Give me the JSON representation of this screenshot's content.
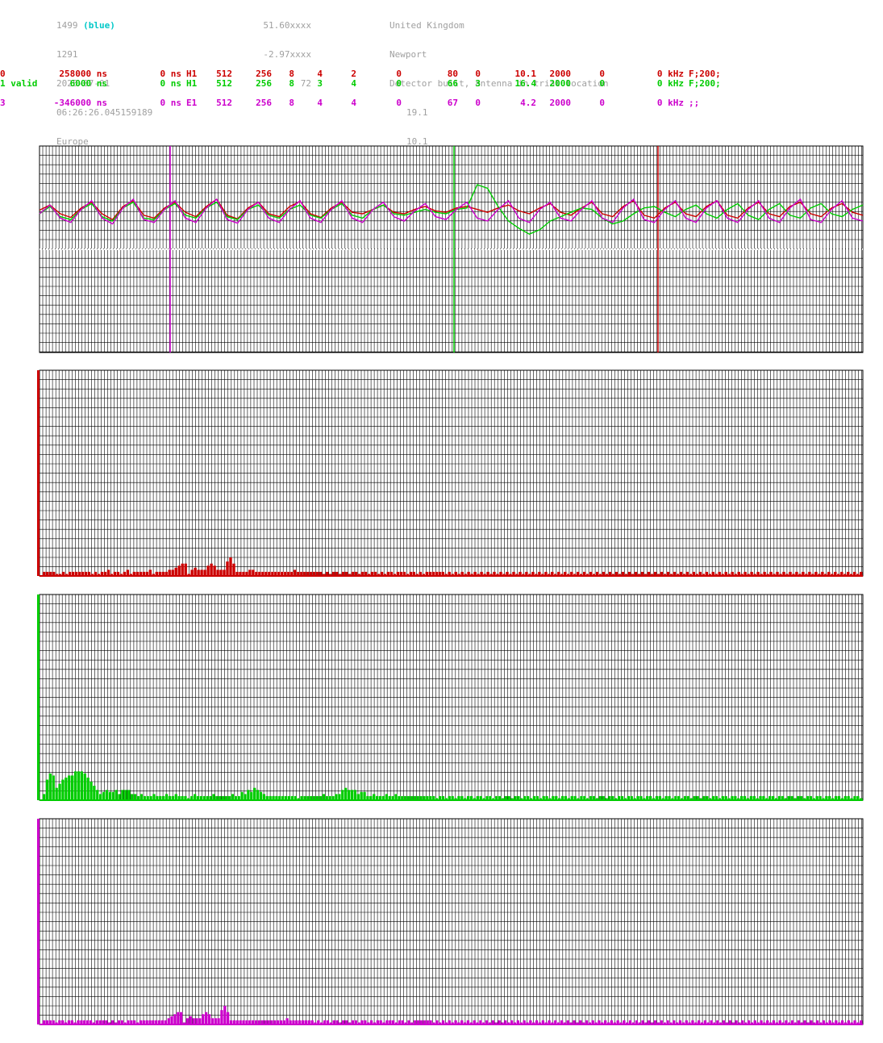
{
  "header": {
    "station_id": "1499",
    "station_color": "(blue)",
    "col1_line2": "1291",
    "col1_line3": "2025-07-01",
    "col1_line4": "06:26:26.045159189",
    "col1_line5": "Europe",
    "col2_line1": "51.60xxxx",
    "col2_line2": "-2.97xxxx",
    "col2_line3": "72",
    "col3_line1": "United Kingdom",
    "col3_line2": "Newport",
    "col3_line3": "Detector built, antenna in trial location",
    "col3_line4": "19.1",
    "col3_line5": "10.1"
  },
  "channels": [
    {
      "color": "#cc0000",
      "f0": "0",
      "f1": "258000 ns",
      "f2": "0 ns",
      "f3": "H1",
      "f4": "512",
      "f5": "256",
      "f6": "8",
      "f7": "4",
      "f8": "2",
      "f9": "0",
      "f10": "80",
      "f11": "0",
      "f12": "10.1",
      "f13": "2000",
      "f14": "0",
      "f15": "0 kHz",
      "f16": "F;200;"
    },
    {
      "color": "#00cc00",
      "f0": "1 valid",
      "f1": "6000 ns",
      "f2": "0 ns",
      "f3": "H1",
      "f4": "512",
      "f5": "256",
      "f6": "8",
      "f7": "3",
      "f8": "4",
      "f9": "0",
      "f10": "66",
      "f11": "3",
      "f12": "16.4",
      "f13": "2000",
      "f14": "0",
      "f15": "0 kHz",
      "f16": "F;200;"
    },
    {
      "color": "#cc00cc",
      "f0": "3",
      "f1": "-346000 ns",
      "f2": "0 ns",
      "f3": "E1",
      "f4": "512",
      "f5": "256",
      "f6": "8",
      "f7": "4",
      "f8": "4",
      "f9": "0",
      "f10": "67",
      "f11": "0",
      "f12": "4.2",
      "f13": "2000",
      "f14": "0",
      "f15": "0 kHz",
      "f16": ";;"
    }
  ],
  "chart_data": [
    {
      "type": "line",
      "series": [
        {
          "color": "#cc0000",
          "waveform": [
            0.55,
            0.62,
            0.5,
            0.45,
            0.58,
            0.66,
            0.5,
            0.42,
            0.6,
            0.68,
            0.48,
            0.44,
            0.58,
            0.66,
            0.52,
            0.46,
            0.6,
            0.7,
            0.48,
            0.43,
            0.58,
            0.66,
            0.5,
            0.46,
            0.6,
            0.67,
            0.5,
            0.45,
            0.58,
            0.66,
            0.52,
            0.5,
            0.56,
            0.62,
            0.52,
            0.5,
            0.56,
            0.6,
            0.54,
            0.52,
            0.58,
            0.6,
            0.56,
            0.52,
            0.58,
            0.62,
            0.54,
            0.5,
            0.58,
            0.64,
            0.52,
            0.48,
            0.58,
            0.66,
            0.5,
            0.46,
            0.6,
            0.68,
            0.48,
            0.44,
            0.58,
            0.66,
            0.5,
            0.46,
            0.6,
            0.68,
            0.48,
            0.44,
            0.58,
            0.66,
            0.5,
            0.46,
            0.6,
            0.66,
            0.5,
            0.46,
            0.58,
            0.64,
            0.52,
            0.48
          ]
        },
        {
          "color": "#00cc00",
          "waveform": [
            0.5,
            0.6,
            0.46,
            0.42,
            0.56,
            0.64,
            0.46,
            0.4,
            0.58,
            0.66,
            0.44,
            0.42,
            0.56,
            0.64,
            0.48,
            0.44,
            0.58,
            0.66,
            0.46,
            0.42,
            0.56,
            0.62,
            0.48,
            0.44,
            0.56,
            0.62,
            0.48,
            0.44,
            0.56,
            0.64,
            0.48,
            0.44,
            0.56,
            0.62,
            0.5,
            0.48,
            0.52,
            0.56,
            0.52,
            0.5,
            0.56,
            0.58,
            0.9,
            0.85,
            0.6,
            0.4,
            0.3,
            0.22,
            0.28,
            0.4,
            0.46,
            0.52,
            0.58,
            0.56,
            0.44,
            0.36,
            0.4,
            0.5,
            0.58,
            0.6,
            0.52,
            0.46,
            0.56,
            0.62,
            0.5,
            0.44,
            0.56,
            0.64,
            0.48,
            0.42,
            0.56,
            0.64,
            0.48,
            0.44,
            0.58,
            0.64,
            0.5,
            0.46,
            0.56,
            0.62
          ]
        },
        {
          "color": "#cc00cc",
          "waveform": [
            0.5,
            0.62,
            0.44,
            0.38,
            0.56,
            0.68,
            0.44,
            0.36,
            0.58,
            0.7,
            0.42,
            0.38,
            0.56,
            0.68,
            0.44,
            0.38,
            0.58,
            0.7,
            0.42,
            0.37,
            0.56,
            0.66,
            0.44,
            0.38,
            0.56,
            0.68,
            0.44,
            0.38,
            0.56,
            0.68,
            0.44,
            0.38,
            0.56,
            0.66,
            0.46,
            0.4,
            0.54,
            0.64,
            0.46,
            0.42,
            0.56,
            0.66,
            0.44,
            0.4,
            0.56,
            0.68,
            0.44,
            0.38,
            0.56,
            0.66,
            0.44,
            0.4,
            0.56,
            0.68,
            0.44,
            0.38,
            0.58,
            0.7,
            0.42,
            0.38,
            0.56,
            0.68,
            0.44,
            0.38,
            0.58,
            0.68,
            0.44,
            0.38,
            0.56,
            0.68,
            0.44,
            0.38,
            0.58,
            0.7,
            0.42,
            0.38,
            0.56,
            0.68,
            0.44,
            0.4
          ]
        }
      ]
    },
    {
      "type": "bar",
      "color": "#cc0000",
      "values": [
        100,
        2,
        2,
        2,
        2,
        1,
        1,
        2,
        1,
        2,
        2,
        2,
        2,
        2,
        2,
        2,
        1,
        2,
        1,
        2,
        2,
        3,
        1,
        2,
        2,
        1,
        2,
        3,
        1,
        2,
        2,
        2,
        2,
        2,
        3,
        1,
        2,
        2,
        2,
        2,
        3,
        3,
        4,
        5,
        6,
        6,
        1,
        3,
        4,
        3,
        3,
        3,
        5,
        6,
        5,
        3,
        3,
        3,
        7,
        9,
        6,
        2,
        2,
        2,
        2,
        3,
        3,
        2,
        2,
        2,
        2,
        2,
        2,
        2,
        2,
        2,
        2,
        2,
        2,
        3,
        2,
        2,
        2,
        2,
        2,
        2,
        2,
        2,
        1,
        2,
        1,
        2,
        2,
        1,
        2,
        2,
        1,
        2,
        2,
        1,
        2,
        2,
        1,
        2,
        2,
        1,
        2,
        1,
        2,
        2,
        1,
        2,
        2,
        2,
        1,
        2,
        2,
        1,
        2,
        1,
        2,
        2,
        2,
        2,
        2,
        2,
        1,
        2,
        1,
        2,
        1,
        2,
        1,
        2,
        1,
        2,
        1,
        2,
        1,
        2,
        1,
        2,
        1,
        2,
        1,
        2,
        1,
        2,
        1,
        2,
        1,
        2,
        1,
        2,
        1,
        2,
        1,
        2,
        1,
        2,
        1,
        2,
        1,
        2,
        1,
        2,
        1,
        2,
        1,
        2,
        1,
        2,
        1,
        2,
        1,
        2,
        1,
        2,
        1,
        2,
        1,
        2,
        1,
        2,
        1,
        2,
        1,
        2,
        1,
        2,
        1,
        2,
        1,
        2,
        1,
        2,
        1,
        2,
        1,
        2,
        1,
        2,
        1,
        2,
        1,
        2,
        1,
        2,
        1,
        2,
        1,
        2,
        1,
        2,
        1,
        2,
        1,
        2,
        1,
        2,
        1,
        2,
        1,
        2,
        1,
        2,
        1,
        2,
        1,
        2,
        1,
        2,
        1,
        2,
        1,
        2,
        1,
        2,
        1,
        2,
        1,
        2,
        1,
        2,
        1,
        2,
        1,
        2,
        1,
        2,
        1,
        2,
        1,
        2,
        1,
        2
      ]
    },
    {
      "type": "bar",
      "color": "#00cc00",
      "values": [
        100,
        3,
        10,
        13,
        12,
        6,
        8,
        10,
        11,
        12,
        12,
        14,
        14,
        14,
        13,
        11,
        9,
        7,
        5,
        3,
        4,
        5,
        4,
        4,
        5,
        3,
        5,
        5,
        5,
        3,
        3,
        2,
        3,
        2,
        2,
        2,
        3,
        2,
        2,
        2,
        3,
        2,
        2,
        3,
        2,
        2,
        2,
        1,
        2,
        3,
        2,
        2,
        2,
        2,
        2,
        3,
        2,
        2,
        2,
        2,
        2,
        3,
        2,
        2,
        4,
        3,
        5,
        4,
        6,
        5,
        4,
        3,
        2,
        2,
        2,
        2,
        2,
        2,
        2,
        2,
        2,
        2,
        1,
        2,
        2,
        2,
        2,
        2,
        2,
        2,
        3,
        2,
        2,
        2,
        3,
        3,
        5,
        6,
        5,
        5,
        5,
        3,
        4,
        4,
        2,
        2,
        3,
        2,
        2,
        2,
        3,
        2,
        2,
        3,
        2,
        2,
        2,
        2,
        2,
        2,
        2,
        2,
        2,
        2,
        2,
        2,
        1,
        2,
        2,
        1,
        2,
        2,
        1,
        2,
        2,
        1,
        2,
        2,
        1,
        2,
        2,
        1,
        2,
        2,
        1,
        2,
        2,
        1,
        2,
        2,
        1,
        2,
        2,
        1,
        2,
        2,
        1,
        2,
        2,
        1,
        2,
        2,
        1,
        2,
        2,
        1,
        2,
        2,
        1,
        2,
        2,
        1,
        2,
        2,
        1,
        2,
        2,
        1,
        2,
        2,
        1,
        2,
        2,
        1,
        2,
        2,
        1,
        2,
        2,
        1,
        2,
        2,
        1,
        2,
        2,
        1,
        2,
        2,
        1,
        2,
        2,
        1,
        2,
        2,
        1,
        2,
        2,
        1,
        2,
        2,
        1,
        2,
        2,
        1,
        2,
        2,
        1,
        2,
        2,
        1,
        2,
        2,
        1,
        2,
        2,
        1,
        2,
        2,
        1,
        2,
        2,
        1,
        2,
        2,
        1,
        2,
        2,
        1,
        2,
        2,
        1,
        2,
        2,
        1,
        2,
        2,
        1,
        2,
        2,
        1,
        2,
        2,
        1,
        2,
        2,
        1,
        2,
        2,
        1,
        2,
        2,
        1
      ]
    },
    {
      "type": "bar",
      "color": "#cc00cc",
      "values": [
        100,
        2,
        2,
        2,
        2,
        1,
        2,
        2,
        1,
        2,
        2,
        1,
        2,
        2,
        2,
        2,
        2,
        1,
        2,
        2,
        2,
        2,
        1,
        2,
        1,
        2,
        2,
        1,
        2,
        2,
        2,
        1,
        2,
        2,
        2,
        2,
        2,
        2,
        2,
        2,
        2,
        3,
        4,
        5,
        6,
        6,
        1,
        3,
        4,
        3,
        3,
        3,
        5,
        6,
        5,
        3,
        3,
        3,
        7,
        9,
        6,
        2,
        2,
        2,
        2,
        2,
        2,
        2,
        2,
        2,
        2,
        2,
        2,
        2,
        2,
        2,
        2,
        2,
        2,
        3,
        2,
        2,
        2,
        2,
        2,
        2,
        2,
        2,
        1,
        2,
        1,
        2,
        2,
        1,
        2,
        2,
        1,
        2,
        2,
        1,
        2,
        2,
        1,
        2,
        2,
        1,
        2,
        1,
        2,
        2,
        1,
        2,
        2,
        2,
        1,
        2,
        2,
        1,
        2,
        1,
        2,
        2,
        2,
        2,
        2,
        2,
        1,
        2,
        1,
        2,
        1,
        2,
        1,
        2,
        1,
        2,
        1,
        2,
        1,
        2,
        1,
        2,
        1,
        2,
        1,
        2,
        1,
        2,
        1,
        2,
        1,
        2,
        1,
        2,
        1,
        2,
        1,
        2,
        1,
        2,
        1,
        2,
        1,
        2,
        1,
        2,
        1,
        2,
        1,
        2,
        1,
        2,
        1,
        2,
        1,
        2,
        1,
        2,
        1,
        2,
        1,
        2,
        1,
        2,
        1,
        2,
        1,
        2,
        1,
        2,
        1,
        2,
        1,
        2,
        1,
        2,
        1,
        2,
        1,
        2,
        1,
        2,
        1,
        2,
        1,
        2,
        1,
        2,
        1,
        2,
        1,
        2,
        1,
        2,
        1,
        2,
        1,
        2,
        1,
        2,
        1,
        2,
        1,
        2,
        1,
        2,
        1,
        2,
        1,
        2,
        1,
        2,
        1,
        2,
        1,
        2,
        1,
        2,
        1,
        2,
        1,
        2,
        1,
        2,
        1,
        2,
        1,
        2,
        1,
        2,
        1,
        2,
        1,
        2,
        1,
        2,
        1,
        2,
        1,
        2,
        1,
        2,
        1,
        2
      ]
    }
  ]
}
